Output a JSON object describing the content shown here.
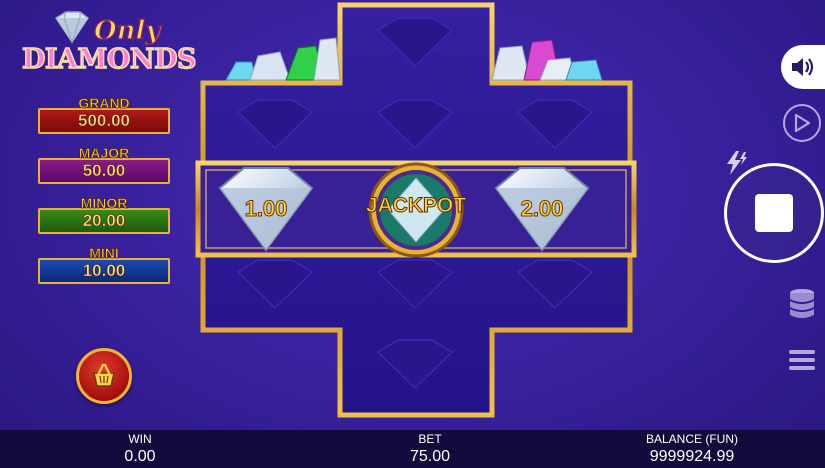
{
  "game": {
    "logo_top": "Only",
    "logo_bottom": "DIAMONDS"
  },
  "jackpots": [
    {
      "label": "GRAND",
      "value": "500.00",
      "color": "#b01818"
    },
    {
      "label": "MAJOR",
      "value": "50.00",
      "color": "#8a1a8a"
    },
    {
      "label": "MINOR",
      "value": "20.00",
      "color": "#3a8a1a"
    },
    {
      "label": "MINI",
      "value": "10.00",
      "color": "#1a4ab0"
    }
  ],
  "board": {
    "middle_row": [
      {
        "type": "diamond",
        "value": "1.00"
      },
      {
        "type": "jackpot",
        "value": "JACKPOT"
      },
      {
        "type": "diamond",
        "value": "2.00"
      }
    ],
    "frame_color": "#e8b23a",
    "cell_color": "#2a1a8a"
  },
  "controls": {
    "sound": "speaker-icon",
    "autoplay": "play-circle-icon",
    "turbo": "lightning-icon",
    "spin": "stop-icon",
    "bet": "coin-stack-icon",
    "menu": "hamburger-icon",
    "buy": "basket-icon"
  },
  "status_bar": {
    "win_label": "WIN",
    "win_value": "0.00",
    "bet_label": "BET",
    "bet_value": "75.00",
    "balance_label": "BALANCE (FUN)",
    "balance_value": "9999924.99"
  }
}
